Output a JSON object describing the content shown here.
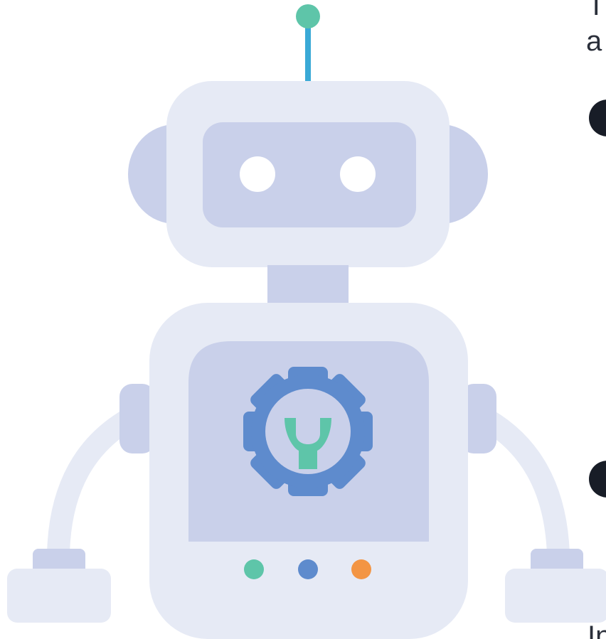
{
  "illustration": {
    "name": "robot-illustration",
    "icon": "robot-icon",
    "chest_icon": "gear-wrench-icon",
    "colors": {
      "body_light": "#e6eaf5",
      "body_panel": "#c9d0ea",
      "gear": "#5e8bcd",
      "wrench": "#5ec5a9",
      "antenna_stem": "#3aa9d6",
      "antenna_ball": "#5ec5a9",
      "eye": "#ffffff",
      "dot_green": "#5ec5a9",
      "dot_blue": "#5e8bcd",
      "dot_orange": "#f39544"
    }
  },
  "side_text": {
    "line1": "T",
    "line2": "a",
    "line3": "In"
  }
}
